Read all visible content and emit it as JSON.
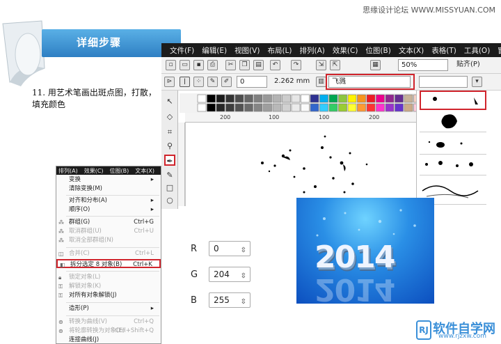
{
  "watermark": "思缘设计论坛  WWW.MISSYUAN.COM",
  "banner": {
    "title": "详细步骤"
  },
  "step": {
    "text": "11. 用艺术笔画出斑点图，打散，填充颜色"
  },
  "menubar": {
    "items": [
      "文件(F)",
      "编辑(E)",
      "视图(V)",
      "布局(L)",
      "排列(A)",
      "效果(C)",
      "位图(B)",
      "文本(X)",
      "表格(T)",
      "工具(O)",
      "窗"
    ]
  },
  "toolbar": {
    "zoom": "50%",
    "snap": "贴齐(P)",
    "size_value": "0",
    "width_value": "2.262 mm",
    "preset": "飞溅"
  },
  "ruler": {
    "labels": [
      "200",
      "100",
      "100",
      "200"
    ]
  },
  "menu": {
    "head": [
      "排列(A)",
      "效果(C)",
      "位图(B)",
      "文本(X)"
    ],
    "items": [
      {
        "label": "变换",
        "shortcut": "",
        "dim": false
      },
      {
        "label": "清除变换(M)",
        "shortcut": "",
        "dim": false
      },
      {
        "label": "对齐和分布(A)",
        "shortcut": "",
        "dim": false
      },
      {
        "label": "顺序(O)",
        "shortcut": "",
        "dim": false
      },
      {
        "label": "群组(G)",
        "shortcut": "Ctrl+G",
        "dim": false
      },
      {
        "label": "取消群组(U)",
        "shortcut": "Ctrl+U",
        "dim": true
      },
      {
        "label": "取消全部群组(N)",
        "shortcut": "",
        "dim": true
      },
      {
        "label": "合并(C)",
        "shortcut": "Ctrl+L",
        "dim": true
      },
      {
        "label": "拆分选定 8 对象(B)",
        "shortcut": "Ctrl+K",
        "dim": false
      },
      {
        "label": "锁定对象(L)",
        "shortcut": "",
        "dim": true
      },
      {
        "label": "解锁对象(K)",
        "shortcut": "",
        "dim": true
      },
      {
        "label": "对所有对象解锁(J)",
        "shortcut": "",
        "dim": false
      },
      {
        "label": "造形(P)",
        "shortcut": "",
        "dim": false
      },
      {
        "label": "转换为曲线(V)",
        "shortcut": "Ctrl+Q",
        "dim": true
      },
      {
        "label": "将轮廓转换为对象(E)",
        "shortcut": "Ctrl+Shift+Q",
        "dim": true
      },
      {
        "label": "连接曲线(J)",
        "shortcut": "",
        "dim": false
      }
    ]
  },
  "rgb": {
    "r_label": "R",
    "r": "0",
    "g_label": "G",
    "g": "204",
    "b_label": "B",
    "b": "255"
  },
  "image": {
    "year": "2014"
  },
  "logo": {
    "text": "软件自学网",
    "sub": "www.rjzxw.com",
    "badge": "RJ"
  },
  "colors": {
    "accent_red": "#d0242c",
    "banner_blue": "#2e7fc3",
    "fill_color": "#00ccff"
  }
}
